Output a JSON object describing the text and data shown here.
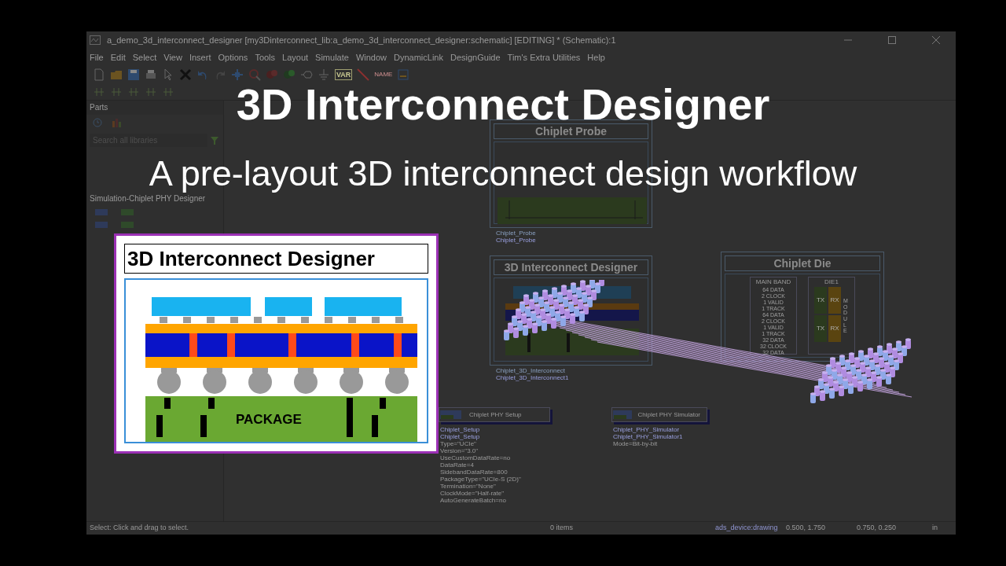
{
  "window": {
    "title": "a_demo_3d_interconnect_designer [my3Dinterconnect_lib:a_demo_3d_interconnect_designer:schematic] [EDITING] * (Schematic):1"
  },
  "menu": [
    "File",
    "Edit",
    "Select",
    "View",
    "Insert",
    "Options",
    "Tools",
    "Layout",
    "Simulate",
    "Window",
    "DynamicLink",
    "DesignGuide",
    "Tim's Extra Utilities",
    "Help"
  ],
  "toolbar_labels": [
    "VAR",
    "NAME"
  ],
  "parts": {
    "title": "Parts",
    "search": {
      "placeholder": "Search all libraries"
    },
    "library": "Simulation-Chiplet PHY Designer"
  },
  "canvas": {
    "blocks": [
      {
        "kind": "probe",
        "title": "Chiplet Probe",
        "labels": [
          "Chiplet_Probe",
          "Chiplet_Probe"
        ]
      },
      {
        "kind": "interconnect",
        "title": "3D Interconnect Designer",
        "labels": [
          "Chiplet_3D_Interconnect",
          "Chiplet_3D_Interconnect1"
        ]
      },
      {
        "kind": "die",
        "title": "Chiplet Die",
        "band": "MAIN BAND",
        "die": "DIE1",
        "pins": [
          "64 DATA",
          "2 CLOCK",
          "1 VALID",
          "1 TRACK",
          "64 DATA",
          "2 CLOCK",
          "1 VALID",
          "1 TRACK",
          "32 DATA",
          "32 CLOCK",
          "32 DATA"
        ],
        "lanes": [
          "TX",
          "RX",
          "TX",
          "RX"
        ],
        "module": "MODULE"
      }
    ],
    "components": [
      {
        "title": "Chiplet PHY Setup",
        "params": [
          "Chiplet_Setup",
          "Chiplet_Setup",
          "Type=\"UCIe\"",
          "Version=\"3.0\"",
          "UseCustomDataRate=no",
          "DataRate=4",
          "SidebandDataRate=800",
          "PackageType=\"UCIe-S (2D)\"",
          "Termination=\"None\"",
          "ClockMode=\"Half-rate\"",
          "AutoGenerateBatch=no"
        ]
      },
      {
        "title": "Chiplet PHY Simulator",
        "params": [
          "Chiplet_PHY_Simulator",
          "Chiplet_PHY_Simulator1",
          "Mode=Bit-by-bit"
        ]
      }
    ]
  },
  "status_bar": {
    "message": "Select: Click and drag to select.",
    "items": "0 items",
    "layer": "ads_device:drawing",
    "coord_1": "0.500, 1.750",
    "coord_2": "0.750, 0.250",
    "unit": "in"
  },
  "overlay": {
    "title": "3D Interconnect Designer",
    "subtitle": "A pre-layout 3D interconnect design workflow"
  },
  "inset": {
    "title": "3D Interconnect Designer",
    "package_label": "PACKAGE"
  }
}
